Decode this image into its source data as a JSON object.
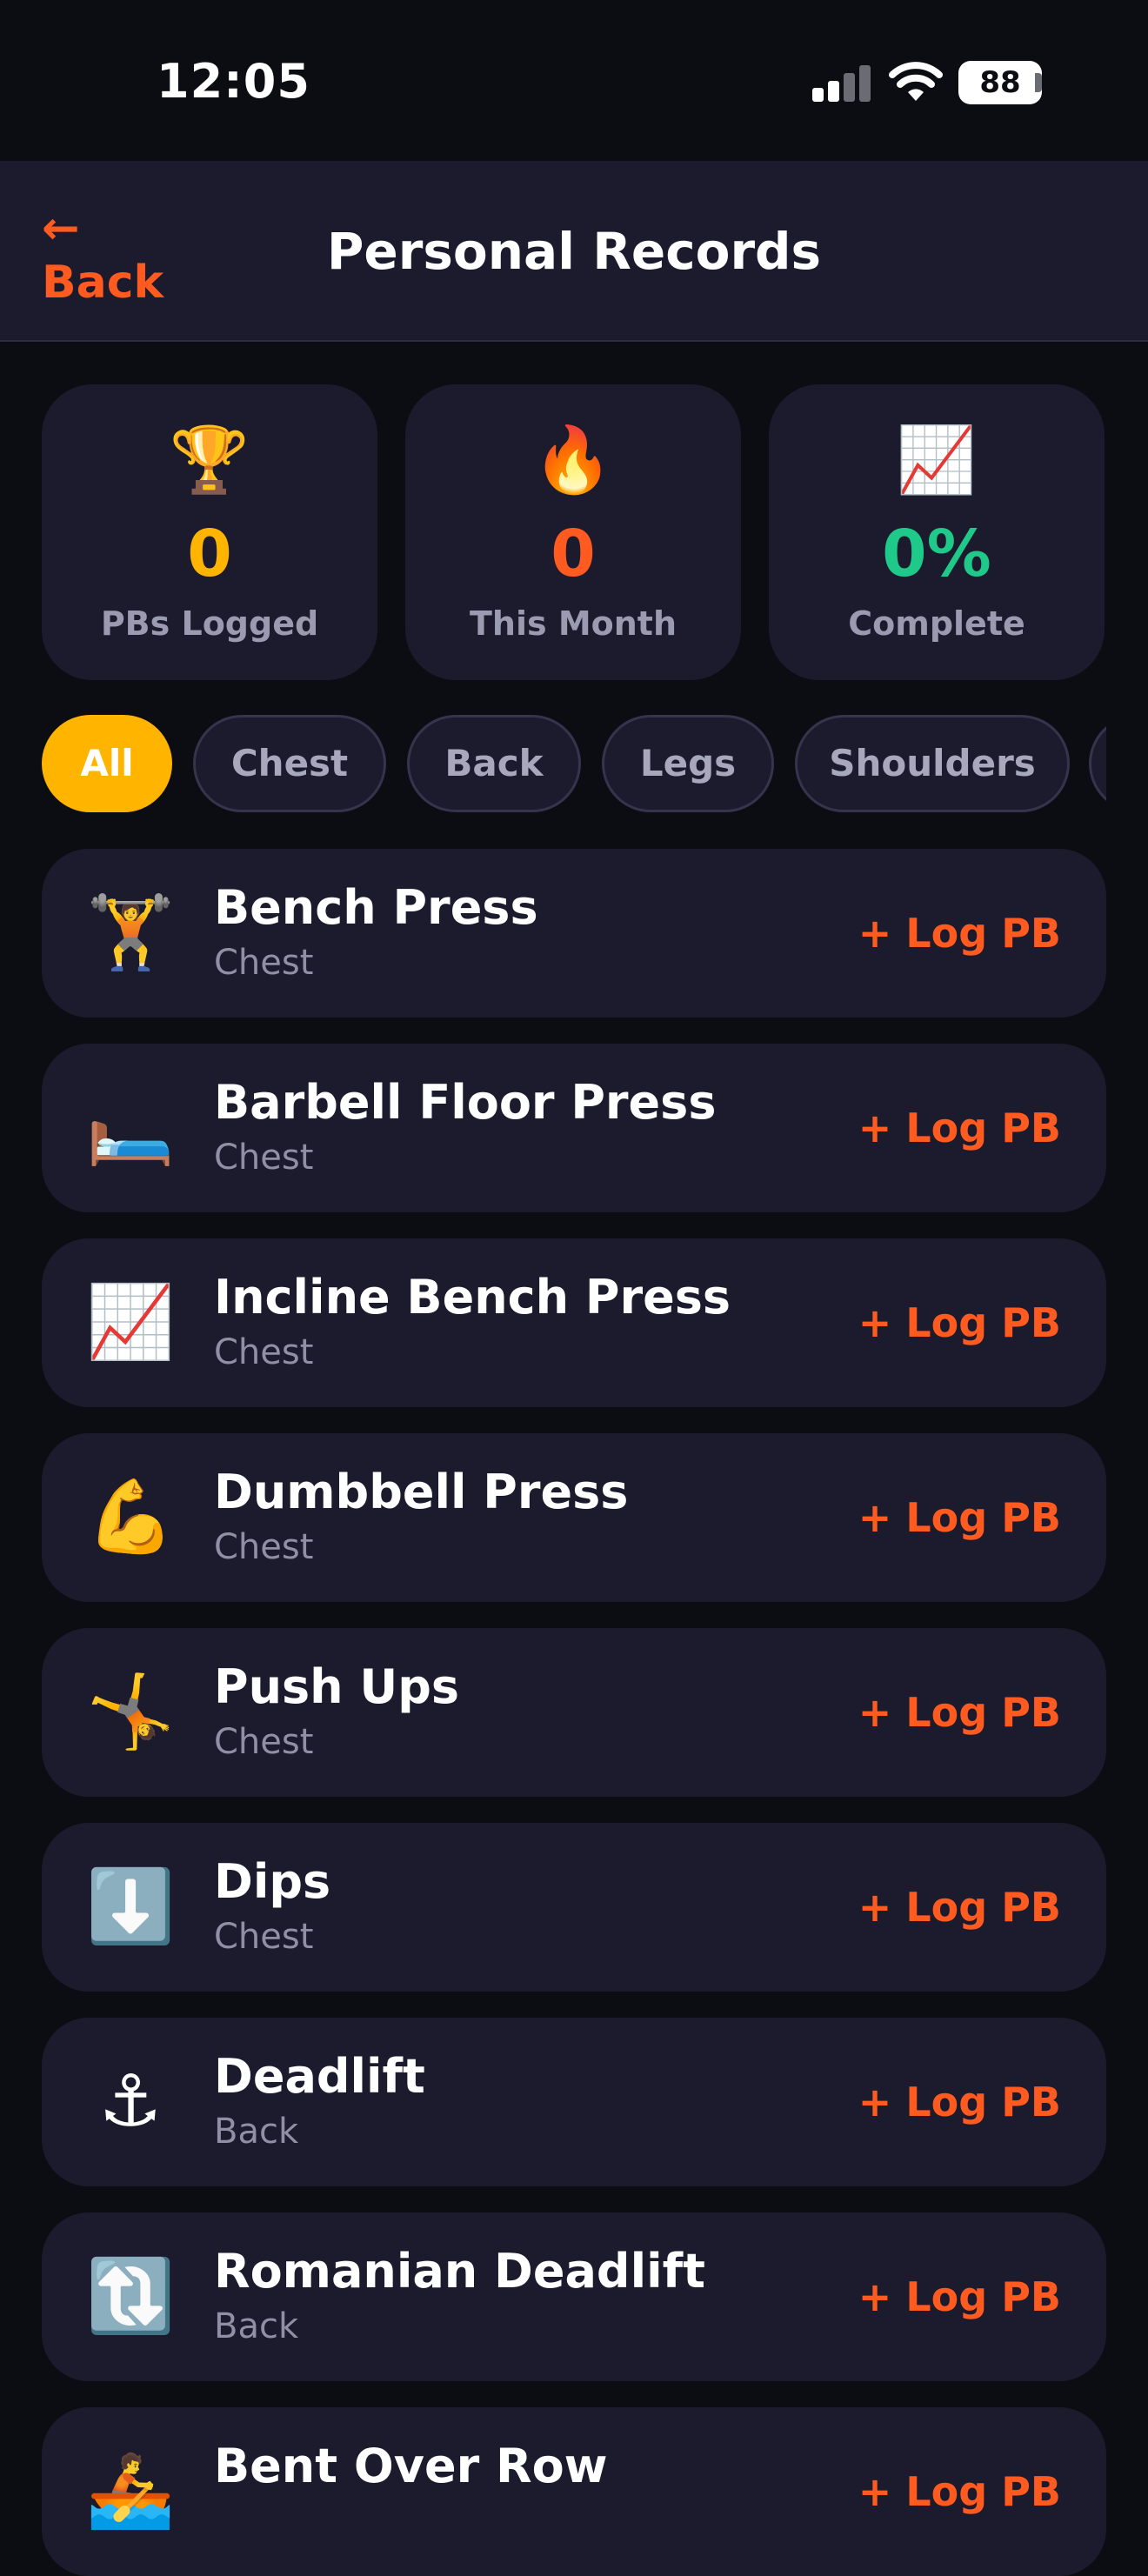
{
  "status_bar": {
    "time": "12:05",
    "battery": "88"
  },
  "header": {
    "back_arrow": "←",
    "back_label": "Back",
    "title": "Personal Records"
  },
  "stats": [
    {
      "icon": "🏆",
      "icon_name": "trophy-icon",
      "value": "0",
      "label": "PBs Logged",
      "color": "#ffb400"
    },
    {
      "icon": "🔥",
      "icon_name": "fire-icon",
      "value": "0",
      "label": "This Month",
      "color": "#ff5a1f"
    },
    {
      "icon": "📈",
      "icon_name": "chart-increasing-icon",
      "value": "0%",
      "label": "Complete",
      "color": "#1ec98a"
    }
  ],
  "filters": {
    "selected": "All",
    "chips": [
      "All",
      "Chest",
      "Back",
      "Legs",
      "Shoulders",
      ""
    ]
  },
  "exercises": [
    {
      "icon": "🏋️",
      "icon_name": "weightlifter-icon",
      "name": "Bench Press",
      "group": "Chest",
      "action": "+ Log PB"
    },
    {
      "icon": "🛏️",
      "icon_name": "bed-icon",
      "name": "Barbell Floor Press",
      "group": "Chest",
      "action": "+ Log PB"
    },
    {
      "icon": "📈",
      "icon_name": "chart-increasing-icon",
      "name": "Incline Bench Press",
      "group": "Chest",
      "action": "+ Log PB"
    },
    {
      "icon": "💪",
      "icon_name": "flexed-biceps-icon",
      "name": "Dumbbell Press",
      "group": "Chest",
      "action": "+ Log PB"
    },
    {
      "icon": "🤸",
      "icon_name": "cartwheel-icon",
      "name": "Push Ups",
      "group": "Chest",
      "action": "+ Log PB"
    },
    {
      "icon": "⬇️",
      "icon_name": "down-arrow-icon",
      "name": "Dips",
      "group": "Chest",
      "action": "+ Log PB"
    },
    {
      "icon": "⚓",
      "icon_name": "anchor-icon",
      "name": "Deadlift",
      "group": "Back",
      "action": "+ Log PB"
    },
    {
      "icon": "🔃",
      "icon_name": "clockwise-arrows-icon",
      "name": "Romanian Deadlift",
      "group": "Back",
      "action": "+ Log PB"
    },
    {
      "icon": "🚣",
      "icon_name": "rowing-icon",
      "name": "Bent Over Row",
      "group": "",
      "action": "+ Log PB"
    }
  ]
}
